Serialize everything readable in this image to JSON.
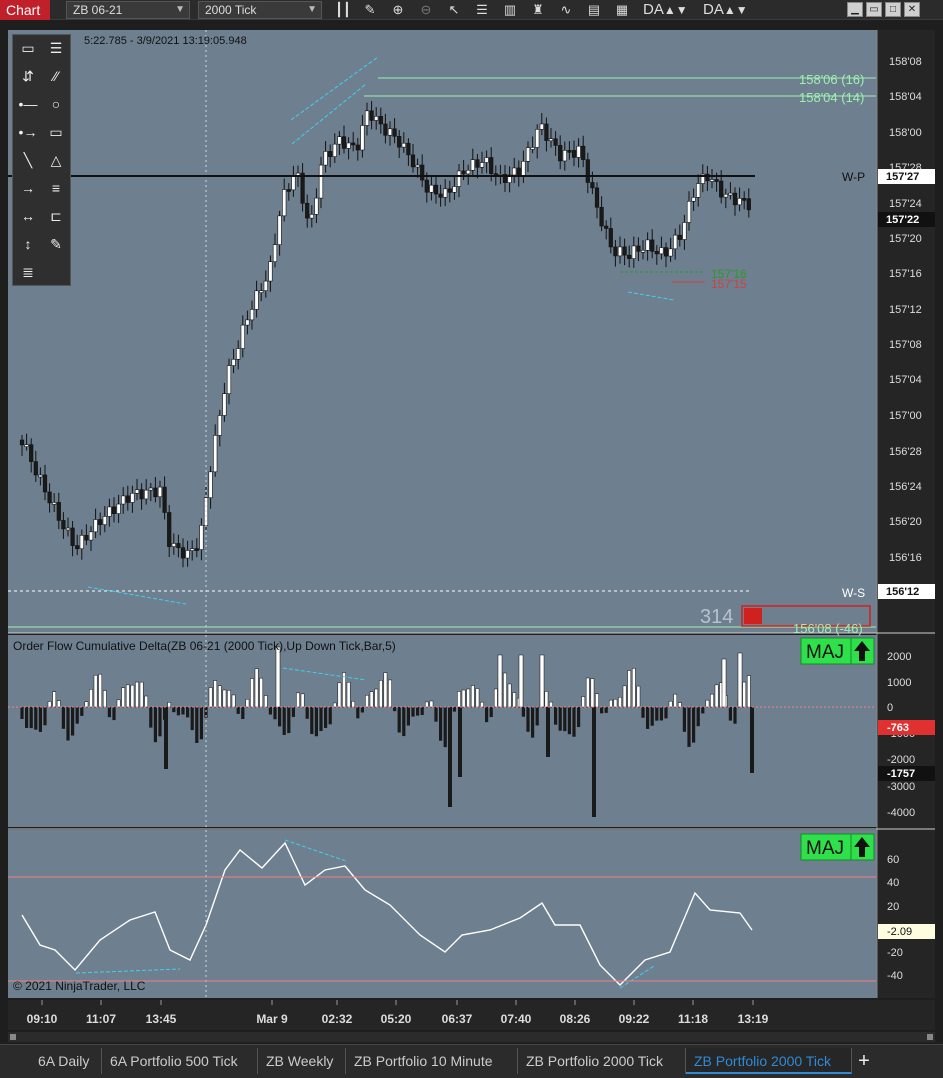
{
  "toolbar": {
    "chart_label": "Chart",
    "instrument": "ZB 06-21",
    "bar_type": "2000 Tick",
    "da1": "DA",
    "da2": "DA",
    "icons": [
      "candlestick-icon",
      "pencil-icon",
      "zoom-in-icon",
      "zoom-out-icon",
      "pointer-icon",
      "properties-icon",
      "data-box-icon",
      "strategy-icon",
      "notes-icon",
      "scroll-icon"
    ]
  },
  "window_buttons": [
    "minimize-icon",
    "restore-icon",
    "maximize-icon",
    "close-icon"
  ],
  "drawing_tools": [
    "ruler-icon",
    "menu-icon",
    "risk-reward-icon",
    "line-icon",
    "horizontal-line-icon",
    "ellipse-icon",
    "ray-icon",
    "rectangle-icon",
    "extended-line-icon",
    "triangle-icon",
    "arrow-line-icon",
    "fib-retracement-icon",
    "horizontal-ray-icon",
    "region-icon",
    "vertical-line-icon",
    "pencil-icon",
    "more-icon"
  ],
  "price_panel": {
    "header": "5:22.785 - 3/9/2021 13:19:05.948",
    "price_ticks": [
      "158'08",
      "158'04",
      "158'00",
      "157'28",
      "157'24",
      "157'20",
      "157'16",
      "157'12",
      "157'08",
      "157'04",
      "157'00",
      "156'28",
      "156'24",
      "156'20",
      "156'16",
      "156'12"
    ],
    "markers": [
      {
        "label": "157'27",
        "style": "light"
      },
      {
        "label": "157'22",
        "style": "dark"
      },
      {
        "label": "156'12",
        "style": "light"
      }
    ],
    "lines": [
      {
        "label": "158'06 (16)",
        "color": "#9ff0b0"
      },
      {
        "label": "158'04 (14)",
        "color": "#9ff0b0"
      },
      {
        "label": "157'16",
        "color": "#2a9a2a"
      },
      {
        "label": "157'15",
        "color": "#d04040"
      },
      {
        "label": "156'08 (-46)",
        "color": "#9ff0b0"
      }
    ],
    "w_pivot_label": "W-P",
    "w_s_label": "W-S",
    "counter": "314"
  },
  "delta_panel": {
    "title": "Order Flow Cumulative Delta(ZB 06-21 (2000 Tick),Up Down Tick,Bar,5)",
    "badge": "MAJ",
    "ticks": [
      "2000",
      "1000",
      "0",
      "-1000",
      "-2000",
      "-3000",
      "-4000"
    ],
    "markers": [
      {
        "label": "-763",
        "style": "red"
      },
      {
        "label": "-1757",
        "style": "dark"
      }
    ]
  },
  "osc_panel": {
    "badge": "MAJ",
    "ticks": [
      "60",
      "40",
      "20",
      "0",
      "-20",
      "-40"
    ],
    "marker": "-2.09",
    "copyright": "© 2021 NinjaTrader, LLC"
  },
  "time_axis": [
    "09:10",
    "11:07",
    "13:45",
    "Mar 9",
    "02:32",
    "05:20",
    "06:37",
    "07:40",
    "08:26",
    "09:22",
    "11:18",
    "13:19"
  ],
  "tabs": [
    {
      "label": "6A Daily",
      "active": false
    },
    {
      "label": "6A Portfolio 500 Tick",
      "active": false
    },
    {
      "label": "ZB Weekly",
      "active": false
    },
    {
      "label": "ZB Portfolio 10 Minute",
      "active": false
    },
    {
      "label": "ZB Portfolio 2000 Tick",
      "active": false
    },
    {
      "label": "ZB Portfolio 2000 Tick",
      "active": true
    }
  ],
  "colors": {
    "panel_bg": "#6e7f8f",
    "up_candle": "#ffffff",
    "down_candle": "#1a1a1a",
    "trend_line": "#40d0f0",
    "badge_green": "#2ee04a"
  }
}
